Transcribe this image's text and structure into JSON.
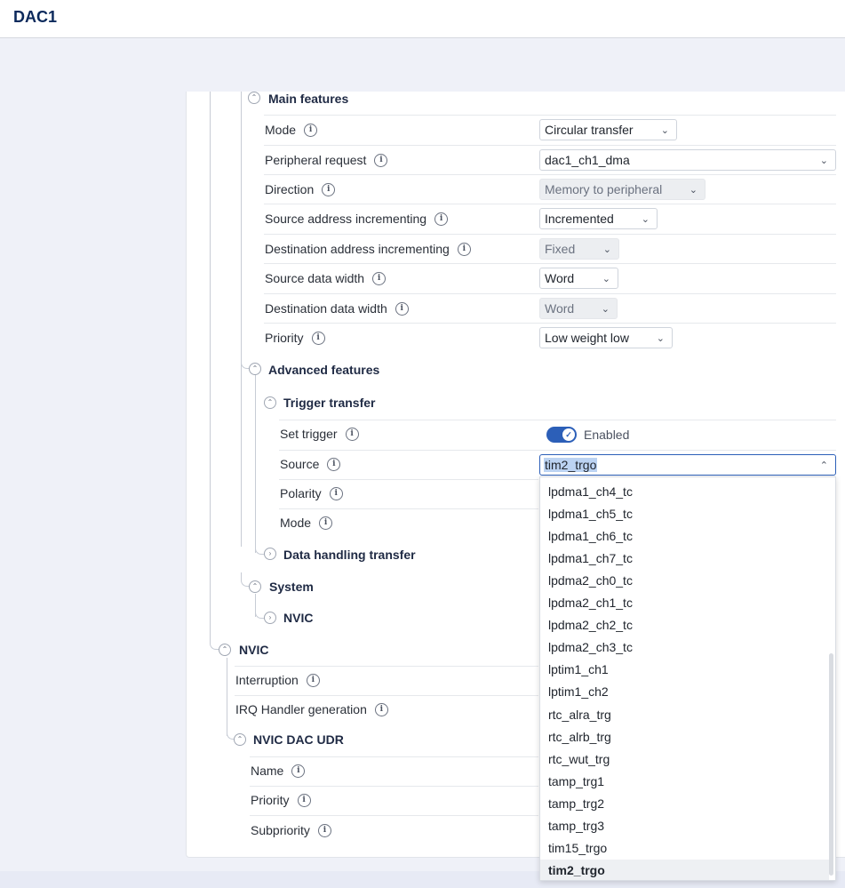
{
  "app": {
    "title": "DAC1"
  },
  "sections": {
    "main_features": "Main features",
    "advanced_features": "Advanced features",
    "trigger_transfer": "Trigger transfer",
    "data_handling_transfer": "Data handling transfer",
    "system": "System",
    "system_nvic": "NVIC",
    "nvic": "NVIC",
    "nvic_dac_udr": "NVIC DAC UDR"
  },
  "main_rows": [
    {
      "label": "Mode",
      "value": "Circular transfer",
      "disabled": false
    },
    {
      "label": "Peripheral request",
      "value": "dac1_ch1_dma",
      "disabled": false
    },
    {
      "label": "Direction",
      "value": "Memory to peripheral",
      "disabled": true
    },
    {
      "label": "Source address incrementing",
      "value": "Incremented",
      "disabled": false
    },
    {
      "label": "Destination address incrementing",
      "value": "Fixed",
      "disabled": true
    },
    {
      "label": "Source data width",
      "value": "Word",
      "disabled": false
    },
    {
      "label": "Destination data width",
      "value": "Word",
      "disabled": true
    },
    {
      "label": "Priority",
      "value": "Low weight low",
      "disabled": false
    }
  ],
  "trigger": {
    "set_trigger_label": "Set trigger",
    "set_trigger_state": "Enabled",
    "source_label": "Source",
    "source_value": "tim2_trgo",
    "polarity_label": "Polarity",
    "mode_label": "Mode"
  },
  "nvic": {
    "interruption_label": "Interruption",
    "irq_label": "IRQ Handler generation"
  },
  "nvic_dac_udr": {
    "name_label": "Name",
    "priority_label": "Priority",
    "subpriority_label": "Subpriority"
  },
  "dropdown_options": [
    "lpdma1_ch4_tc",
    "lpdma1_ch5_tc",
    "lpdma1_ch6_tc",
    "lpdma1_ch7_tc",
    "lpdma2_ch0_tc",
    "lpdma2_ch1_tc",
    "lpdma2_ch2_tc",
    "lpdma2_ch3_tc",
    "lptim1_ch1",
    "lptim1_ch2",
    "rtc_alra_trg",
    "rtc_alrb_trg",
    "rtc_wut_trg",
    "tamp_trg1",
    "tamp_trg2",
    "tamp_trg3",
    "tim15_trgo",
    "tim2_trgo"
  ],
  "selected_option": "tim2_trgo",
  "icons": {
    "info": "info-icon",
    "collapse": "chevron-up-circle-icon",
    "expand": "chevron-right-circle-icon",
    "dropdown": "chevron-down-icon",
    "check": "check-icon"
  },
  "colors": {
    "accent": "#2c5fb8",
    "title": "#0c2a5c",
    "highlight": "#bcd3f2"
  }
}
